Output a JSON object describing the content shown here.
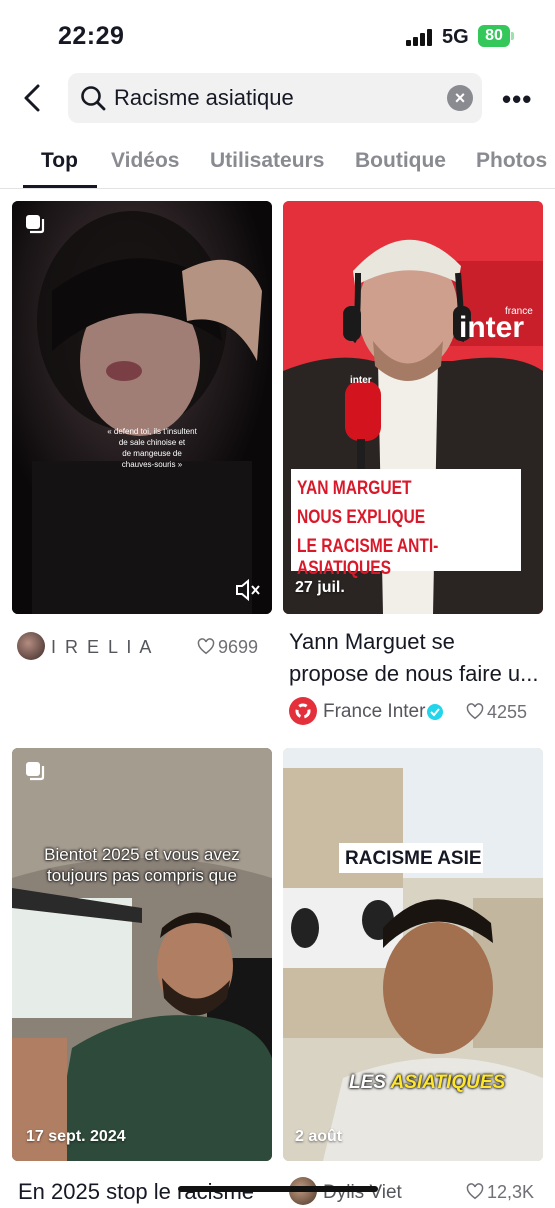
{
  "status": {
    "time": "22:29",
    "network": "5G",
    "battery": "80"
  },
  "search": {
    "query": "Racisme asiatique"
  },
  "tabs": [
    "Top",
    "Vidéos",
    "Utilisateurs",
    "Boutique",
    "Photos"
  ],
  "results": [
    {
      "overlay": "« defend toi, ils t'insultent\nde sale chinoise et\nde mangeuse de\nchauves-souris »",
      "author": "I R E L I A",
      "likes": "9699"
    },
    {
      "date": "27 juil.",
      "overlay_lines": [
        "YAN MARGUET",
        "NOUS EXPLIQUE",
        "LE RACISME ANTI-ASIATIQUES"
      ],
      "logo_small": "france",
      "logo_big": "inter",
      "mic_label": "inter",
      "caption_line1": "Yann Marguet se",
      "caption_line2": "propose de nous faire u...",
      "author": "France Inter",
      "likes": "4255"
    },
    {
      "overlay": "Bientot 2025 et vous avez\ntoujours pas compris que",
      "date": "17 sept. 2024",
      "caption": "En 2025 stop le racisme"
    },
    {
      "overlay_top": "RACISME ASIE",
      "overlay_bottom_a": "LES ",
      "overlay_bottom_b": "ASIATIQUES",
      "date": "2 août",
      "author": "Dylis Viet",
      "likes": "12,3K"
    }
  ]
}
